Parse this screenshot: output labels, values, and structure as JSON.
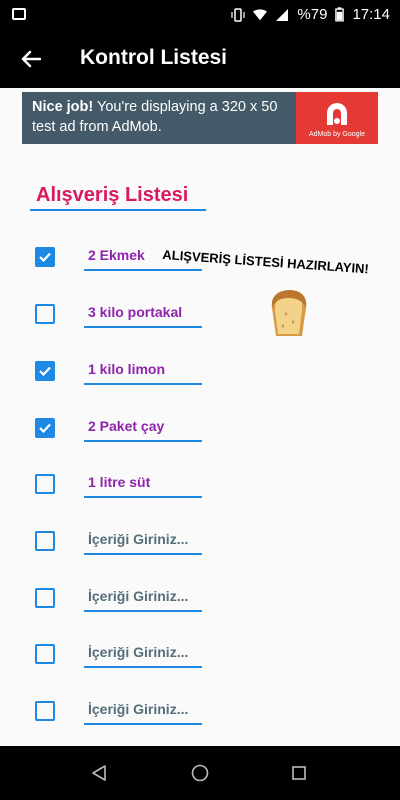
{
  "status_bar": {
    "battery": "%79",
    "time": "17:14"
  },
  "app_bar": {
    "title": "Kontrol Listesi"
  },
  "ad": {
    "bold": "Nice job!",
    "message": " You're displaying a 320 x 50 test ad from AdMob.",
    "brand_caption": "AdMob by Google"
  },
  "list": {
    "title": "Alışveriş Listesi",
    "callout": "ALIŞVERİŞ LİSTESİ HAZIRLAYIN!",
    "items": [
      {
        "text": "2 Ekmek",
        "checked": true,
        "placeholder": false
      },
      {
        "text": "3 kilo portakal",
        "checked": false,
        "placeholder": false
      },
      {
        "text": "1 kilo limon",
        "checked": true,
        "placeholder": false
      },
      {
        "text": "2 Paket çay",
        "checked": true,
        "placeholder": false
      },
      {
        "text": "1 litre süt",
        "checked": false,
        "placeholder": false
      },
      {
        "text": "İçeriği Giriniz...",
        "checked": false,
        "placeholder": true
      },
      {
        "text": "İçeriği Giriniz...",
        "checked": false,
        "placeholder": true
      },
      {
        "text": "İçeriği Giriniz...",
        "checked": false,
        "placeholder": true
      },
      {
        "text": "İçeriği Giriniz...",
        "checked": false,
        "placeholder": true
      }
    ]
  },
  "colors": {
    "accent": "#1e88e5",
    "title": "#d81b60",
    "item_text": "#8e24aa",
    "placeholder": "#546e7a"
  }
}
